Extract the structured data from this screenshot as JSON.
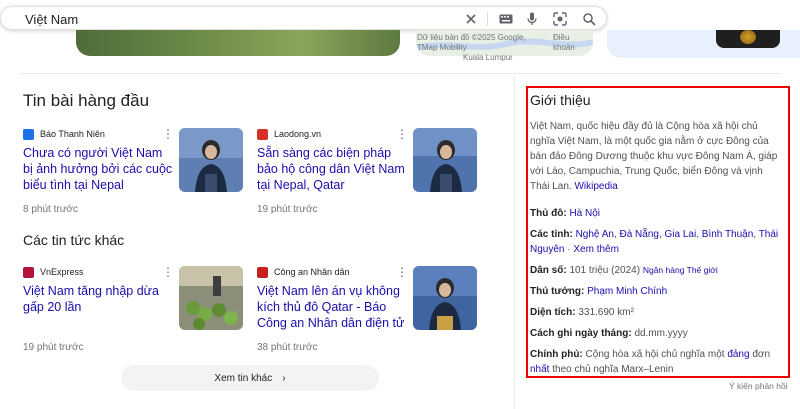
{
  "search": {
    "query": "Việt Nam"
  },
  "top_strip": {
    "map_attribution": "Dữ liệu bản đồ ©2025 Google, TMap Mobility",
    "map_place": "Kuala Lumpur",
    "map_terms": "Điều khoản"
  },
  "top_stories": {
    "heading": "Tin bài hàng đầu",
    "items": [
      {
        "source": "Báo Thanh Niên",
        "title": "Chưa có người Việt Nam bị ảnh hưởng bởi các cuộc biểu tình tại Nepal",
        "time": "8 phút trước",
        "favicon_color": "#1a73e8"
      },
      {
        "source": "Laodong.vn",
        "title": "Sẵn sàng các biện pháp bảo hộ công dân Việt Nam tại Nepal, Qatar",
        "time": "19 phút trước",
        "favicon_color": "#d93025"
      }
    ]
  },
  "other_news": {
    "heading": "Các tin tức khác",
    "items": [
      {
        "source": "VnExpress",
        "title": "Việt Nam tăng nhập dừa gấp 20 lần",
        "time": "19 phút trước",
        "favicon_color": "#b3123b"
      },
      {
        "source": "Công an Nhân dân",
        "title": "Việt Nam lên án vụ không kích thủ đô Qatar - Báo Công an Nhân dân điện tử",
        "time": "38 phút trước",
        "favicon_color": "#c5221f"
      }
    ],
    "more_label": "Xem tin khác"
  },
  "intro": {
    "title": "Giới thiệu",
    "description": "Việt Nam, quốc hiệu đầy đủ là Cộng hòa xã hội chủ nghĩa Việt Nam, là một quốc gia nằm ở cực Đông của bán đảo Đông Dương thuộc khu vực Đông Nam Á, giáp với Lào, Campuchia, Trung Quốc, biển Đông và vịnh Thái Lan.",
    "wiki_link": "Wikipedia",
    "capital_label": "Thủ đô:",
    "capital": "Hà Nội",
    "provinces_label": "Các tỉnh:",
    "provinces": [
      "Nghệ An",
      "Đà Nẵng",
      "Gia Lai",
      "Bình Thuận",
      "Thái Nguyên"
    ],
    "provinces_more": "Xem thêm",
    "population_label": "Dân số:",
    "population": "101 triệu (2024)",
    "population_source": "Ngân hàng Thế giới",
    "pm_label": "Thủ tướng:",
    "pm": "Phạm Minh Chính",
    "area_label": "Diện tích:",
    "area": "331.690 km²",
    "date_label": "Cách ghi ngày tháng:",
    "date_format": "dd.mm.yyyy",
    "gov_label": "Chính phủ:",
    "gov_text1": "Cộng hòa xã hội chủ nghĩa một",
    "gov_link1": "đảng",
    "gov_text2": "đơn",
    "gov_link2": "nhất",
    "gov_text3": "theo chủ nghĩa Marx–Lenin"
  },
  "feedback": "Ý kiến phản hồi",
  "colors": {
    "link": "#1a0dab",
    "highlight_border": "#ee0000"
  }
}
